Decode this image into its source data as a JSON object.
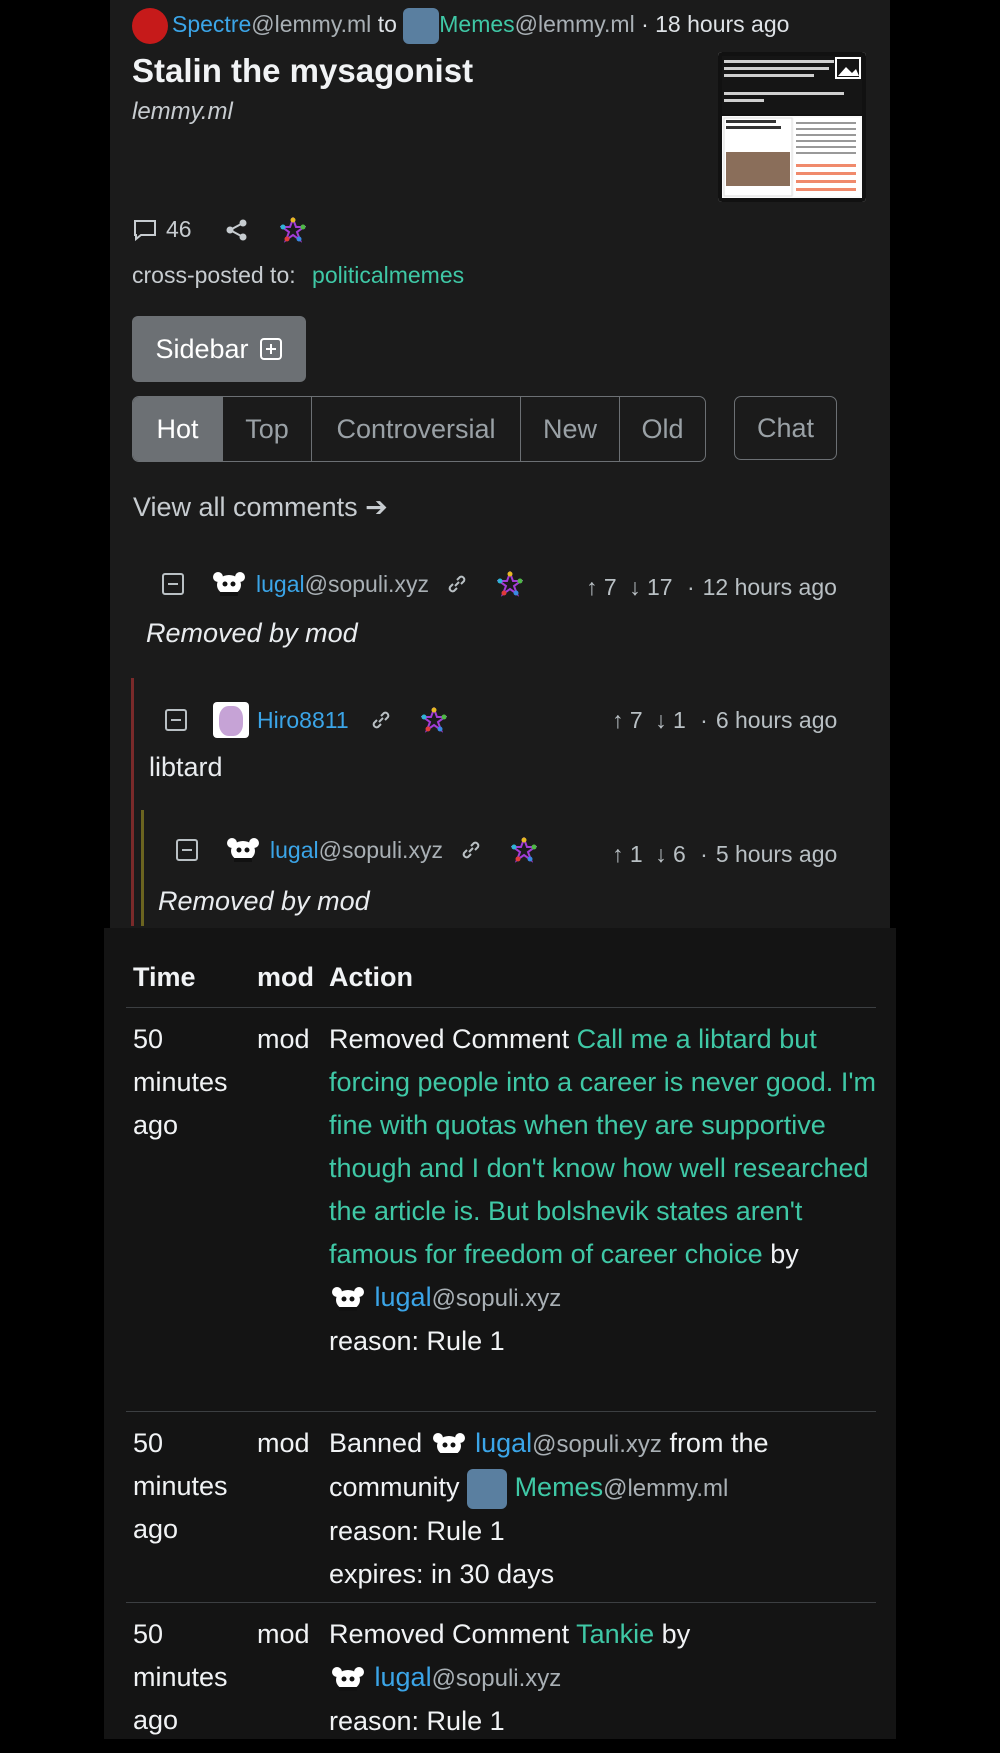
{
  "post": {
    "author_name": "Spectre",
    "author_instance": "@lemmy.ml",
    "to_word": "to",
    "community_name": "Memes",
    "community_instance": "@lemmy.ml",
    "time": "· 18 hours ago",
    "title": "Stalin the mysagonist",
    "domain": "lemmy.ml",
    "comment_count": "46",
    "crosspost_label": "cross-posted to:",
    "crosspost_community": "politicalmemes"
  },
  "buttons": {
    "sidebar": "Sidebar",
    "sort_tabs": [
      "Hot",
      "Top",
      "Controversial",
      "New",
      "Old"
    ],
    "active_tab": "Hot",
    "chat": "Chat",
    "view_all": "View all comments ➔"
  },
  "comments": [
    {
      "user": "lugal",
      "instance": "@sopuli.xyz",
      "up": "7",
      "down": "17",
      "time": "12 hours ago",
      "body": "Removed by mod"
    },
    {
      "user": "Hiro8811",
      "instance": "",
      "up": "7",
      "down": "1",
      "time": "6 hours ago",
      "body": "libtard"
    },
    {
      "user": "lugal",
      "instance": "@sopuli.xyz",
      "up": "1",
      "down": "6",
      "time": "5 hours ago",
      "body": "Removed by mod"
    }
  ],
  "modlog": {
    "headers": {
      "time": "Time",
      "mod": "mod",
      "action": "Action"
    },
    "rows": [
      {
        "time": "50 minutes ago",
        "mod": "mod",
        "verb": "Removed Comment",
        "comment": "Call me a libtard but forcing people into a career is never good. I'm fine with quotas when they are supportive though and I don't know how well researched the article is. But bolshevik states aren't famous for freedom of career choice",
        "by": "by",
        "user": "lugal",
        "instance": "@sopuli.xyz",
        "reason": "reason: Rule 1"
      },
      {
        "time": "50 minutes ago",
        "mod": "mod",
        "verb": "Banned",
        "user": "lugal",
        "instance": "@sopuli.xyz",
        "from": "from the community",
        "community": "Memes",
        "community_instance": "@lemmy.ml",
        "reason": "reason: Rule 1",
        "expires": "expires: in 30 days"
      },
      {
        "time": "50 minutes ago",
        "mod": "mod",
        "verb": "Removed Comment",
        "comment": "Tankie",
        "by": "by",
        "user": "lugal",
        "instance": "@sopuli.xyz",
        "reason": "reason: Rule 1"
      }
    ]
  },
  "colors": {
    "link": "#3ba5e8",
    "teal": "#3fc8a6",
    "panel": "#1b1b1b",
    "button": "#6c7074"
  }
}
